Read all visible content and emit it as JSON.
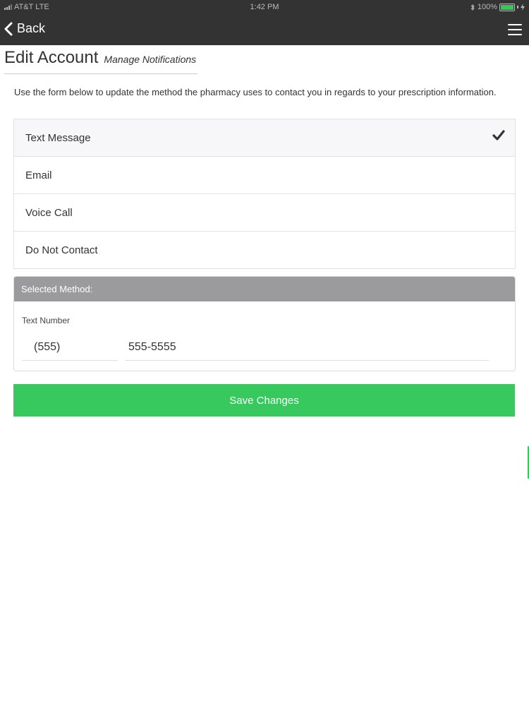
{
  "status_bar": {
    "carrier": "AT&T",
    "network": "LTE",
    "time": "1:42 PM",
    "battery_percent": "100%",
    "battery_level": 1.0,
    "icons": [
      "signal-icon",
      "bluetooth-icon",
      "battery-icon",
      "charging-icon"
    ]
  },
  "nav": {
    "back_label": "Back",
    "icons": [
      "chevron-left-icon",
      "hamburger-menu-icon"
    ]
  },
  "header": {
    "title": "Edit Account",
    "subtitle": "Manage Notifications"
  },
  "intro_text": "Use the form below to update the method the pharmacy uses to contact you in regards to your prescription information.",
  "methods": {
    "items": [
      {
        "label": "Text Message",
        "selected": true
      },
      {
        "label": "Email",
        "selected": false
      },
      {
        "label": "Voice Call",
        "selected": false
      },
      {
        "label": "Do Not Contact",
        "selected": false
      }
    ],
    "selected_icon": "checkmark-icon"
  },
  "selected_method": {
    "header": "Selected Method:",
    "field_label": "Text Number",
    "area_code": "(555)",
    "number": "555-5555"
  },
  "save_button": {
    "label": "Save Changes"
  },
  "colors": {
    "nav_bg": "#333333",
    "accent_green": "#37c95d",
    "panel_header_bg": "#9b9a9c",
    "selected_row_bg": "#f7f6f8"
  }
}
